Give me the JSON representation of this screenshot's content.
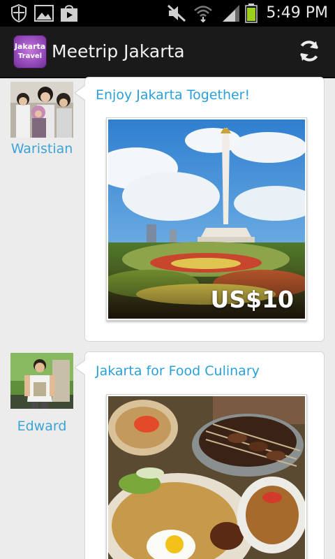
{
  "status_bar": {
    "time": "5:49 PM",
    "icons": [
      "shield-icon",
      "image-icon",
      "play-store-icon",
      "mute-icon",
      "wifi-icon",
      "signal-icon",
      "battery-icon"
    ]
  },
  "action_bar": {
    "logo_line1": "Jakarta",
    "logo_line2": "Travel",
    "title": "Meetrip Jakarta",
    "refresh_icon": "refresh-icon"
  },
  "posts": [
    {
      "author": "Waristian",
      "title": "Enjoy Jakarta Together!",
      "price": "US$10"
    },
    {
      "author": "Edward",
      "title": "Jakarta for Food Culinary",
      "price": ""
    }
  ]
}
